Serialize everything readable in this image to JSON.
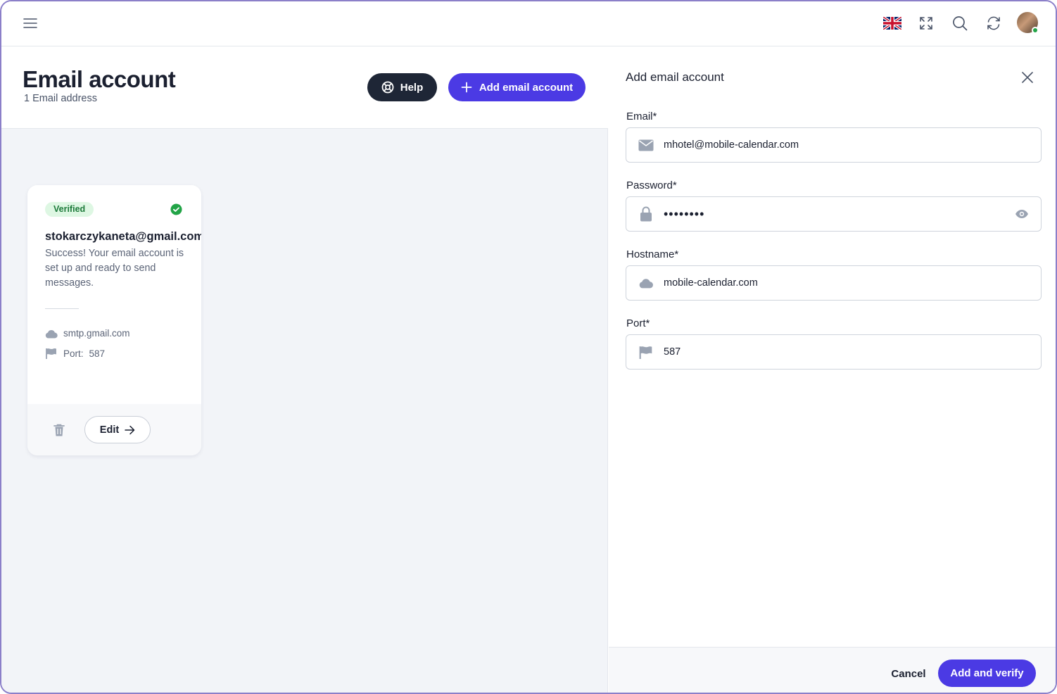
{
  "header": {
    "icons": [
      "menu-icon",
      "uk-flag-icon",
      "fullscreen-icon",
      "search-icon",
      "refresh-icon",
      "avatar"
    ]
  },
  "page": {
    "title": "Email account",
    "subtitle": "1 Email address",
    "help_label": "Help",
    "add_label": "Add email account"
  },
  "card": {
    "badge": "Verified",
    "email": "stokarczykaneta@gmail.com",
    "message": "Success! Your email account is set up and ready to send messages.",
    "host": "smtp.gmail.com",
    "port_label": "Port:",
    "port_value": "587",
    "edit_label": "Edit"
  },
  "panel": {
    "title": "Add email account",
    "email_label": "Email*",
    "email_value": "mhotel@mobile-calendar.com",
    "password_label": "Password*",
    "password_value": "••••••••",
    "hostname_label": "Hostname*",
    "hostname_value": "mobile-calendar.com",
    "port_label": "Port*",
    "port_value": "587",
    "cancel_label": "Cancel",
    "submit_label": "Add and verify"
  },
  "colors": {
    "accent": "#4b3ae4",
    "dark_button": "#1e2636",
    "verified_bg": "#def7e3",
    "verified_text": "#1d7a3a",
    "success": "#22a447",
    "icon_gray": "#9aa3b2"
  }
}
